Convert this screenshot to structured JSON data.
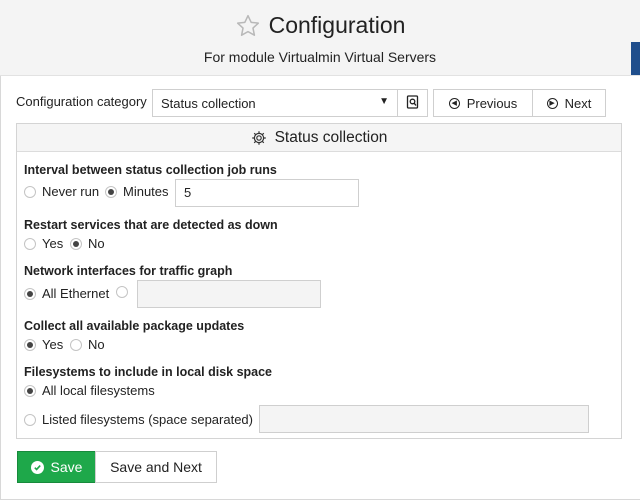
{
  "header": {
    "title": "Configuration",
    "subtitle": "For module Virtualmin Virtual Servers",
    "star_icon": "star-outline-icon",
    "accent_color": "#1f4e8c"
  },
  "category": {
    "label": "Configuration category",
    "selected": "Status collection",
    "search_icon": "search-icon",
    "previous_label": "Previous",
    "next_label": "Next"
  },
  "panel": {
    "title": "Status collection",
    "icon": "gear-icon"
  },
  "fields": {
    "interval": {
      "label": "Interval between status collection job runs",
      "options": [
        "Never run",
        "Minutes"
      ],
      "selected": "Minutes",
      "value": "5"
    },
    "restart": {
      "label": "Restart services that are detected as down",
      "options": [
        "Yes",
        "No"
      ],
      "selected": "No"
    },
    "network": {
      "label": "Network interfaces for traffic graph",
      "options": [
        "All Ethernet",
        ""
      ],
      "selected": "All Ethernet",
      "value": ""
    },
    "packages": {
      "label": "Collect all available package updates",
      "options": [
        "Yes",
        "No"
      ],
      "selected": "Yes"
    },
    "filesystems": {
      "label": "Filesystems to include in local disk space",
      "options": [
        "All local filesystems",
        "Listed filesystems (space separated)"
      ],
      "selected": "All local filesystems",
      "value": ""
    }
  },
  "actions": {
    "save_label": "Save",
    "save_next_label": "Save and Next",
    "save_color": "#1ea84a"
  }
}
